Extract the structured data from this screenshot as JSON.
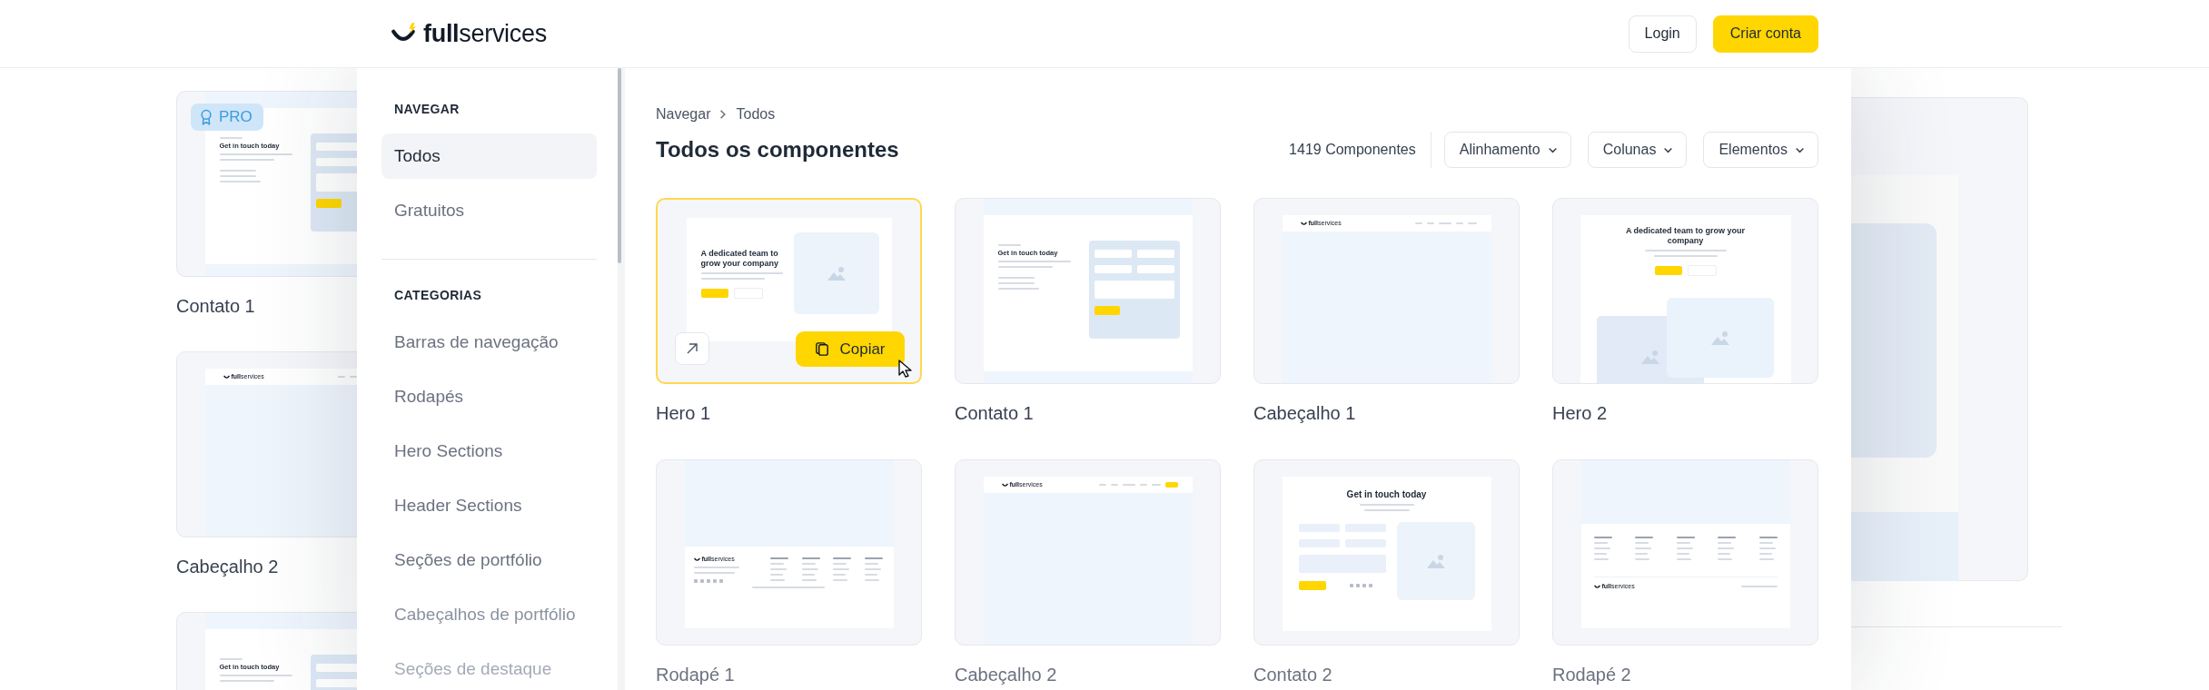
{
  "header": {
    "logo": "**full**services",
    "buttons": [
      {
        "label": "Login",
        "kind": "outline"
      },
      {
        "label": "Criar conta",
        "kind": "primary"
      }
    ]
  },
  "background_left": {
    "cards": [
      {
        "title": "Contato 1",
        "badge": "PRO",
        "preview": {
          "kind": "contact-split",
          "heading": "Get in touch today"
        }
      },
      {
        "title": "Cabeçalho 2",
        "preview": {
          "kind": "navbar-cta",
          "logo": "**full**services"
        }
      },
      {
        "preview": {
          "kind": "contact-split",
          "heading": "Get in touch today"
        }
      }
    ]
  },
  "sidebar": {
    "sections": [
      {
        "title": "NAVEGAR",
        "items": [
          {
            "label": "Todos",
            "selected": true
          },
          {
            "label": "Gratuitos",
            "selected": false
          }
        ]
      },
      {
        "title": "CATEGORIAS",
        "items": [
          {
            "label": "Barras de navegação",
            "selected": false
          },
          {
            "label": "Rodapés",
            "selected": false
          },
          {
            "label": "Hero Sections",
            "selected": false
          },
          {
            "label": "Header Sections",
            "selected": false
          },
          {
            "label": "Seções de portfólio",
            "selected": false
          },
          {
            "label": "Cabeçalhos de portfólio",
            "selected": false
          },
          {
            "label": "Seções de destaque",
            "selected": false
          }
        ]
      }
    ]
  },
  "content": {
    "breadcrumb": [
      "Navegar",
      "Todos"
    ],
    "title": "Todos os componentes",
    "count": "1419 Componentes",
    "filters": [
      "Alinhamento",
      "Colunas",
      "Elementos"
    ],
    "components": [
      {
        "title": "Hero 1",
        "selected": true,
        "copy_label": "Copiar",
        "preview": {
          "kind": "hero-split",
          "heading": "A dedicated team to grow your company"
        }
      },
      {
        "title": "Contato 1",
        "selected": false,
        "preview": {
          "kind": "contact-split",
          "heading": "Get in touch today"
        }
      },
      {
        "title": "Cabeçalho 1",
        "selected": false,
        "preview": {
          "kind": "navbar",
          "logo": "**full**services"
        }
      },
      {
        "title": "Hero 2",
        "selected": false,
        "preview": {
          "kind": "hero-centered",
          "heading": "A dedicated team to grow your company"
        }
      },
      {
        "title": "Rodapé 1",
        "selected": false,
        "preview": {
          "kind": "footer",
          "logo": "**full**services"
        }
      },
      {
        "title": "Cabeçalho 2",
        "selected": false,
        "preview": {
          "kind": "navbar-cta",
          "logo": "**full**services"
        }
      },
      {
        "title": "Contato 2",
        "selected": false,
        "preview": {
          "kind": "contact-centered",
          "heading": "Get in touch today"
        }
      },
      {
        "title": "Rodapé 2",
        "selected": false,
        "preview": {
          "kind": "footer-columns",
          "logo": "**full**services"
        }
      }
    ]
  }
}
